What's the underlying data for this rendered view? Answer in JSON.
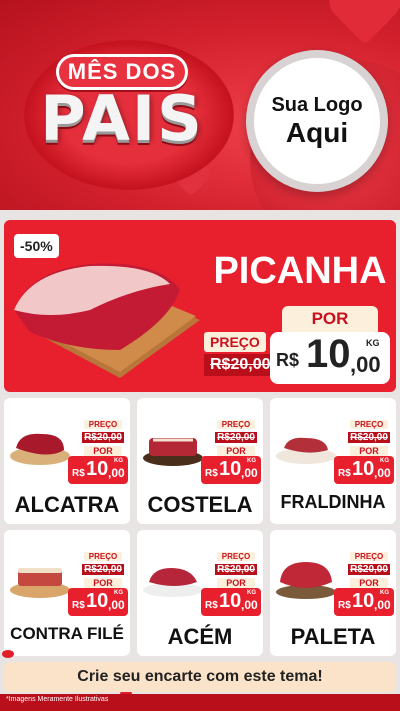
{
  "colors": {
    "brand_red": "#e8202e",
    "dark_red": "#b80f1b",
    "cream": "#fcefdc",
    "white": "#ffffff"
  },
  "header": {
    "ribbon_text": "MÊS DOS",
    "title_text": "PAIS",
    "logo_line1": "Sua Logo",
    "logo_line2": "Aqui"
  },
  "featured": {
    "discount": "-50%",
    "name": "PICANHA",
    "preco_label": "PREÇO",
    "old_price": "R$20,00",
    "por_label": "POR",
    "currency": "R$",
    "price_int": "10",
    "price_cents": ",00",
    "unit": "KG"
  },
  "products": [
    {
      "name": "ALCATRA",
      "preco_label": "PREÇO",
      "old_price": "R$20,00",
      "por_label": "POR",
      "currency": "R$",
      "price_int": "10",
      "price_cents": ",00",
      "unit": "KG"
    },
    {
      "name": "COSTELA",
      "preco_label": "PREÇO",
      "old_price": "R$20,00",
      "por_label": "POR",
      "currency": "R$",
      "price_int": "10",
      "price_cents": ",00",
      "unit": "KG"
    },
    {
      "name": "FRALDINHA",
      "preco_label": "PREÇO",
      "old_price": "R$20,00",
      "por_label": "POR",
      "currency": "R$",
      "price_int": "10",
      "price_cents": ",00",
      "unit": "KG"
    },
    {
      "name": "CONTRA FILÉ",
      "preco_label": "PREÇO",
      "old_price": "R$20,00",
      "por_label": "POR",
      "currency": "R$",
      "price_int": "10",
      "price_cents": ",00",
      "unit": "KG"
    },
    {
      "name": "ACÉM",
      "preco_label": "PREÇO",
      "old_price": "R$20,00",
      "por_label": "POR",
      "currency": "R$",
      "price_int": "10",
      "price_cents": ",00",
      "unit": "KG"
    },
    {
      "name": "PALETA",
      "preco_label": "PREÇO",
      "old_price": "R$20,00",
      "por_label": "POR",
      "currency": "R$",
      "price_int": "10",
      "price_cents": ",00",
      "unit": "KG"
    }
  ],
  "cta": "Crie seu encarte com este tema!",
  "disclaimer": "*Imagens Meramente Ilustrativas"
}
